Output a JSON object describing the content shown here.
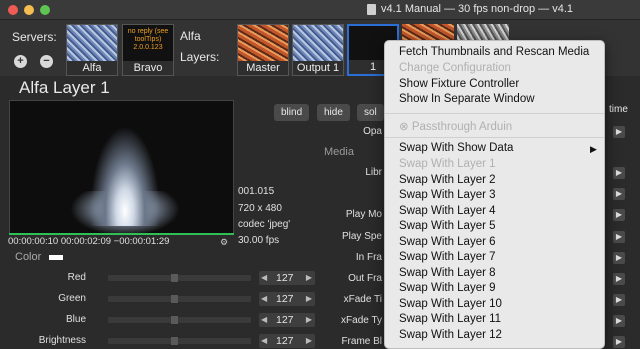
{
  "window": {
    "title": "v4.1 Manual  —  30 fps non-drop  —  v4.1"
  },
  "servers": {
    "label": "Servers:",
    "add_glyph": "+",
    "remove_glyph": "−",
    "items": [
      {
        "label": "Alfa"
      },
      {
        "label": "Bravo",
        "note": "no reply (see toolTips) 2.0.0.123"
      }
    ],
    "current_server_name": "Alfa"
  },
  "layers": {
    "label": "Layers:",
    "items": [
      {
        "label": "Master"
      },
      {
        "label": "Output 1"
      },
      {
        "label": "1"
      }
    ]
  },
  "layer_panel": {
    "title": "Alfa Layer 1",
    "timecode": "00:00:00:10   00:00:02:09  −00:00:01:29",
    "color_label": "Color",
    "frame": "001.015",
    "resolution": "720 x 480",
    "codec": "codec 'jpeg'",
    "fps": "30.00 fps",
    "buttons": {
      "blind": "blind",
      "hide": "hide",
      "solo": "sol"
    },
    "time_label": "time",
    "media_label": "Media",
    "params": [
      "Opa",
      "Libr",
      "Play Mo",
      "Play Spe",
      "In Fra",
      "Out Fra",
      "xFade Ti",
      "xFade Ty",
      "Frame Bl"
    ]
  },
  "sliders": [
    {
      "label": "Red",
      "value": "127"
    },
    {
      "label": "Green",
      "value": "127"
    },
    {
      "label": "Blue",
      "value": "127"
    },
    {
      "label": "Brightness",
      "value": "127"
    }
  ],
  "context_menu": {
    "items": [
      {
        "label": "Fetch Thumbnails and Rescan Media",
        "enabled": true
      },
      {
        "label": "Change Configuration",
        "enabled": false
      },
      {
        "label": "Show Fixture Controller",
        "enabled": true
      },
      {
        "label": "Show In Separate Window",
        "enabled": true
      },
      {
        "label": "⊗ Passthrough Arduin",
        "enabled": false
      },
      {
        "label": "Swap With Show Data",
        "enabled": true,
        "submenu": true
      },
      {
        "label": "Swap With Layer 1",
        "enabled": false
      },
      {
        "label": "Swap With Layer 2",
        "enabled": true
      },
      {
        "label": "Swap With Layer 3",
        "enabled": true
      },
      {
        "label": "Swap With Layer 4",
        "enabled": true
      },
      {
        "label": "Swap With Layer 5",
        "enabled": true
      },
      {
        "label": "Swap With Layer 6",
        "enabled": true
      },
      {
        "label": "Swap With Layer 7",
        "enabled": true
      },
      {
        "label": "Swap With Layer 8",
        "enabled": true
      },
      {
        "label": "Swap With Layer 9",
        "enabled": true
      },
      {
        "label": "Swap With Layer 10",
        "enabled": true
      },
      {
        "label": "Swap With Layer 11",
        "enabled": true
      },
      {
        "label": "Swap With Layer 12",
        "enabled": true
      }
    ]
  },
  "colors": {
    "accent": "#2b6fd6",
    "progress": "#2fbf55",
    "menu_bg": "#e9e9e9"
  }
}
